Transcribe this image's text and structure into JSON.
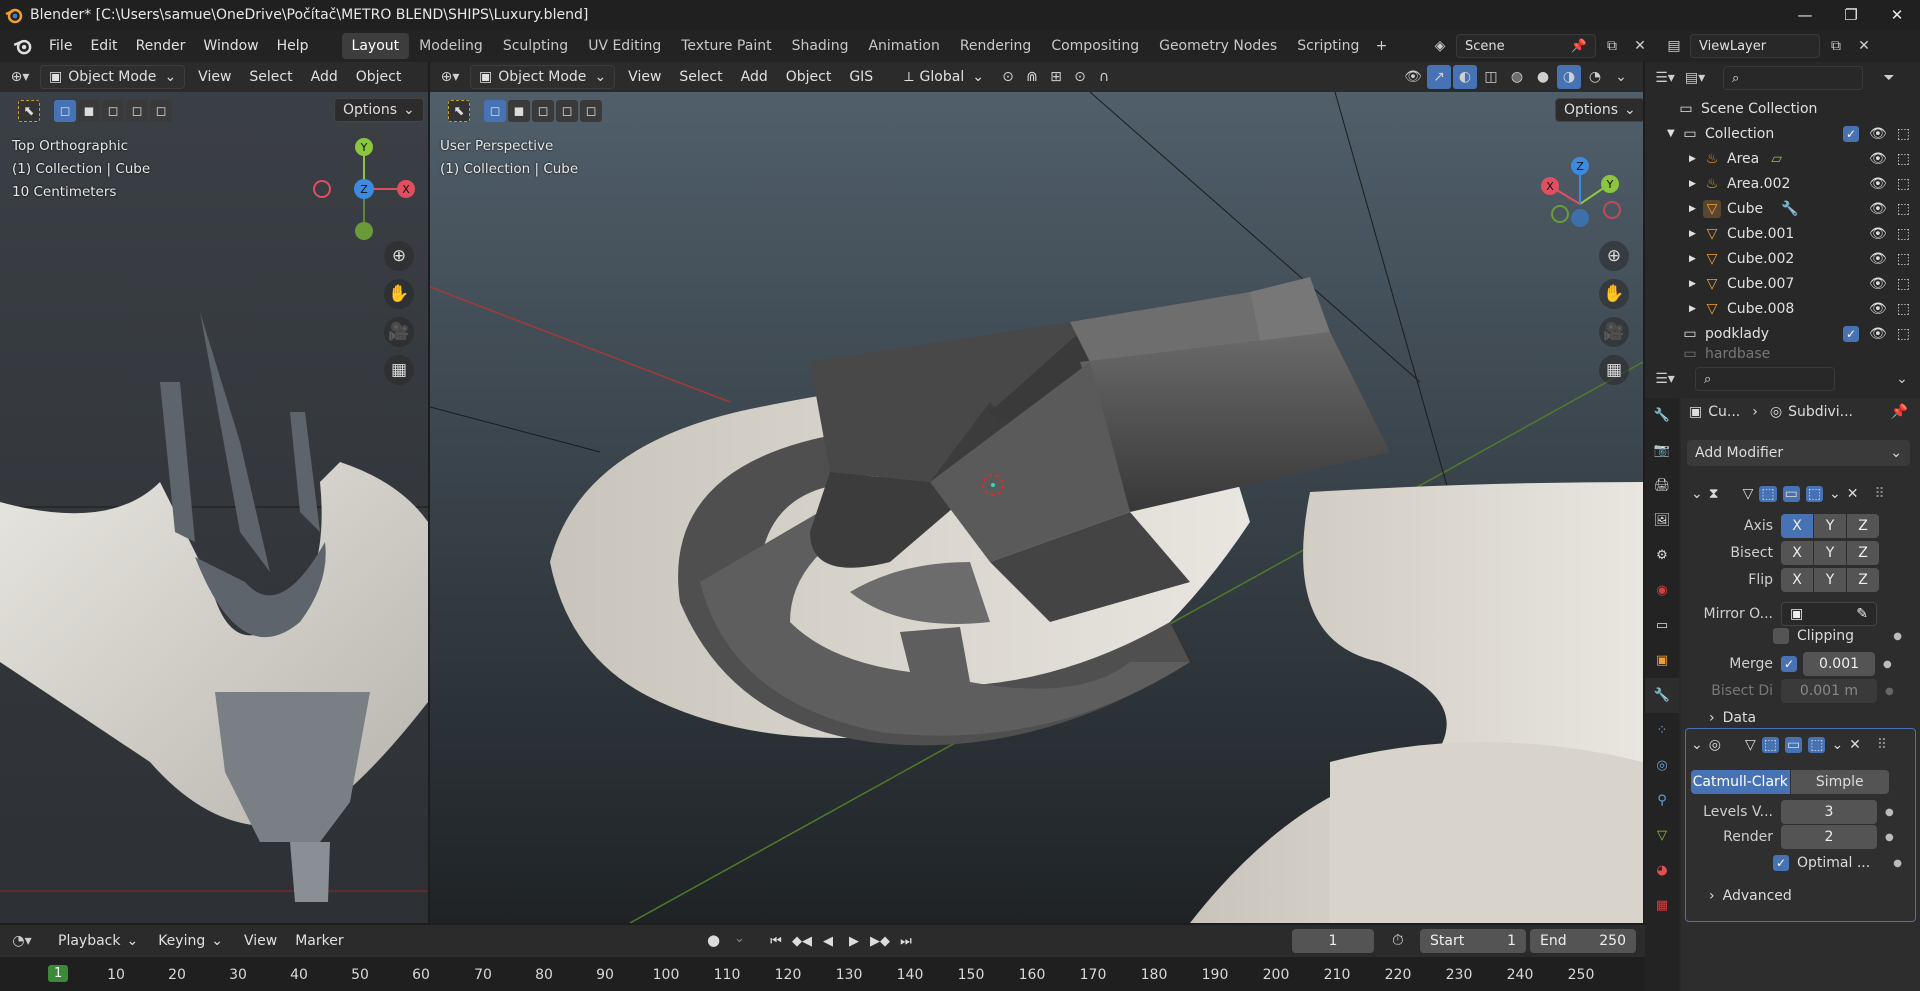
{
  "window": {
    "title": "Blender* [C:\\Users\\samue\\OneDrive\\Počítač\\METRO BLEND\\SHIPS\\Luxury.blend]"
  },
  "menu": [
    "File",
    "Edit",
    "Render",
    "Window",
    "Help"
  ],
  "workspaces": [
    "Layout",
    "Modeling",
    "Sculpting",
    "UV Editing",
    "Texture Paint",
    "Shading",
    "Animation",
    "Rendering",
    "Compositing",
    "Geometry Nodes",
    "Scripting"
  ],
  "active_workspace": "Layout",
  "scene": {
    "name": "Scene"
  },
  "view_layer": {
    "name": "ViewLayer"
  },
  "left_view": {
    "mode": "Object Mode",
    "menus": [
      "View",
      "Select",
      "Add",
      "Object"
    ],
    "options": "Options",
    "overlay_lines": [
      "Top Orthographic",
      "(1) Collection | Cube",
      "10 Centimeters"
    ],
    "gizmo": {
      "y": "Y",
      "z": "Z",
      "x": "X"
    }
  },
  "main_view": {
    "mode": "Object Mode",
    "menus": [
      "View",
      "Select",
      "Add",
      "Object",
      "GIS"
    ],
    "transform": "Global",
    "options": "Options",
    "overlay_lines": [
      "User Perspective",
      "(1) Collection | Cube"
    ],
    "gizmo": {
      "x": "X",
      "y": "Y",
      "z": "Z"
    }
  },
  "outliner": {
    "root": "Scene Collection",
    "collection": "Collection",
    "items": [
      {
        "name": "Area",
        "type": "light"
      },
      {
        "name": "Area.002",
        "type": "light"
      },
      {
        "name": "Cube",
        "type": "mesh",
        "modifier": true
      },
      {
        "name": "Cube.001",
        "type": "mesh"
      },
      {
        "name": "Cube.002",
        "type": "mesh"
      },
      {
        "name": "Cube.007",
        "type": "mesh"
      },
      {
        "name": "Cube.008",
        "type": "mesh"
      }
    ],
    "collection2": "podklady",
    "collection3": "hardbase"
  },
  "properties": {
    "breadcrumb_object": "Cu...",
    "breadcrumb_modifier": "Subdivi...",
    "add_modifier": "Add Modifier",
    "mirror": {
      "axis_label": "Axis",
      "bisect_label": "Bisect",
      "flip_label": "Flip",
      "xyz": [
        "X",
        "Y",
        "Z"
      ],
      "mirror_object_label": "Mirror O...",
      "clipping_label": "Clipping",
      "merge_label": "Merge",
      "merge_value": "0.001",
      "bisect_dist_label": "Bisect Di",
      "bisect_dist_value": "0.001 m",
      "data_label": "Data"
    },
    "subsurf": {
      "catmull": "Catmull-Clark",
      "simple": "Simple",
      "levels_label": "Levels V...",
      "levels_value": "3",
      "render_label": "Render",
      "render_value": "2",
      "optimal_label": "Optimal ...",
      "advanced_label": "Advanced"
    }
  },
  "timeline": {
    "menus": [
      "Playback",
      "Keying",
      "View",
      "Marker"
    ],
    "current_frame": "1",
    "start_label": "Start",
    "start_value": "1",
    "end_label": "End",
    "end_value": "250",
    "ruler_current": "1",
    "ticks": [
      "10",
      "20",
      "30",
      "40",
      "50",
      "60",
      "70",
      "80",
      "90",
      "100",
      "110",
      "120",
      "130",
      "140",
      "150",
      "160",
      "170",
      "180",
      "190",
      "200",
      "210",
      "220",
      "230",
      "240",
      "250"
    ]
  },
  "colors": {
    "accent": "#4772b3",
    "x_axis": "#e04f5f",
    "y_axis": "#8cc63f",
    "z_axis": "#3d8be0",
    "frame_green": "#3a8a3a"
  }
}
